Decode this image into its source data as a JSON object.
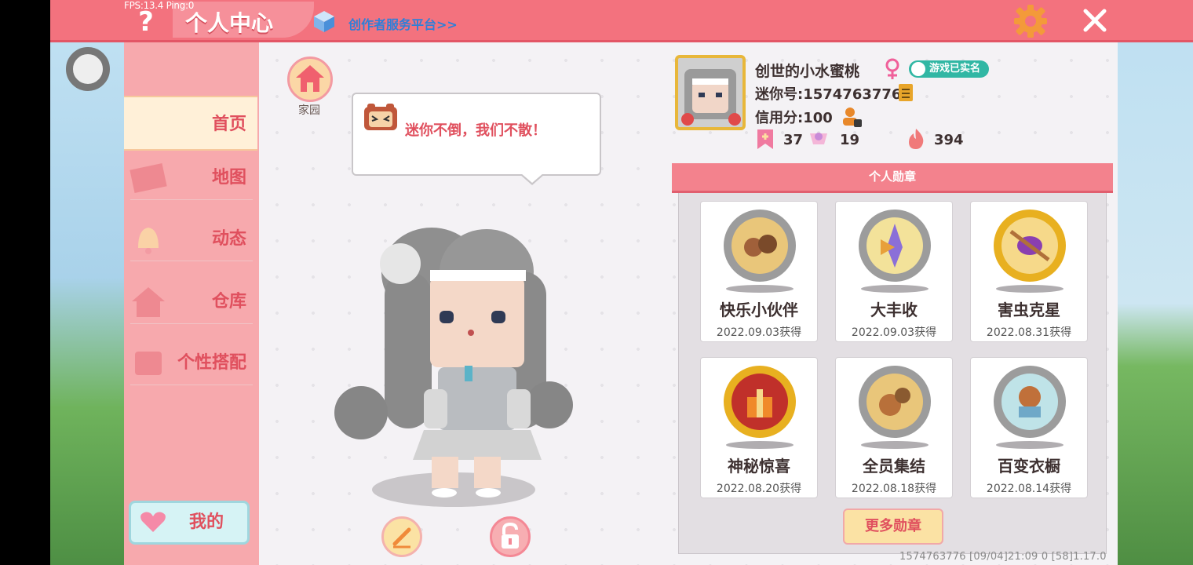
{
  "debug": {
    "fps_ping": "FPS:13.4  Ping:0"
  },
  "header": {
    "title": "个人中心",
    "creator_link": "创作者服务平台>>",
    "icons": [
      "help-icon",
      "cube-icon",
      "gear-icon",
      "close-icon"
    ],
    "accent_color": "#f3727e"
  },
  "sidebar": {
    "items": [
      {
        "label": "首页",
        "active": true
      },
      {
        "label": "地图",
        "active": false
      },
      {
        "label": "动态",
        "active": false
      },
      {
        "label": "仓库",
        "active": false
      },
      {
        "label": "个性搭配",
        "active": false
      }
    ],
    "mine_button": "我的"
  },
  "home": {
    "label": "家园"
  },
  "bubble": {
    "text": "迷你不倒，我们不散！"
  },
  "profile": {
    "username": "创世的小水蜜桃",
    "verified_badge": "游戏已实名",
    "mini_id": "迷你号:1574763776",
    "credit": "信用分:100",
    "stats": [
      {
        "icon": "bookmark-icon",
        "value": "37"
      },
      {
        "icon": "trophy-icon",
        "value": "19"
      },
      {
        "icon": "flame-icon",
        "value": "394"
      }
    ]
  },
  "medals": {
    "header": "个人勋章",
    "items": [
      {
        "name": "快乐小伙伴",
        "date": "2022.09.03获得",
        "tier": "silver"
      },
      {
        "name": "大丰收",
        "date": "2022.09.03获得",
        "tier": "silver"
      },
      {
        "name": "害虫克星",
        "date": "2022.08.31获得",
        "tier": "gold"
      },
      {
        "name": "神秘惊喜",
        "date": "2022.08.20获得",
        "tier": "gold"
      },
      {
        "name": "全员集结",
        "date": "2022.08.18获得",
        "tier": "silver"
      },
      {
        "name": "百变衣橱",
        "date": "2022.08.14获得",
        "tier": "silver"
      }
    ],
    "more_button": "更多勋章"
  },
  "footer": {
    "text": "1574763776    [09/04]21:09 0    [58]1.17.0"
  }
}
